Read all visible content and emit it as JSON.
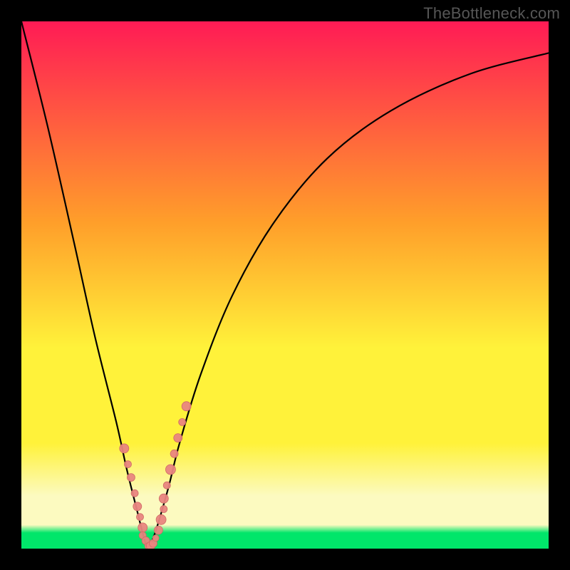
{
  "watermark": "TheBottleneck.com",
  "colors": {
    "gradient_top": "#ff1b55",
    "gradient_mid1": "#ff9e2a",
    "gradient_mid2": "#fff23a",
    "gradient_pale": "#fcfac0",
    "gradient_bottom": "#00e66a",
    "frame": "#000000",
    "curve": "#000000",
    "marker_fill": "#e9857f",
    "marker_stroke": "#cf6b65"
  },
  "chart_data": {
    "type": "line",
    "title": "",
    "xlabel": "",
    "ylabel": "",
    "xlim": [
      0,
      100
    ],
    "ylim": [
      0,
      100
    ],
    "notch_x": 24,
    "series": [
      {
        "name": "bottleneck-curve",
        "x": [
          0,
          5,
          10,
          14,
          18,
          20,
          22,
          23,
          24,
          25,
          26,
          28,
          30,
          34,
          40,
          48,
          58,
          70,
          85,
          100
        ],
        "values": [
          100,
          80,
          58,
          40,
          24,
          15,
          7,
          3,
          0,
          2,
          5,
          12,
          20,
          33,
          48,
          62,
          74,
          83,
          90,
          94
        ]
      }
    ],
    "markers": {
      "name": "sample-points",
      "x": [
        19.5,
        20.2,
        20.8,
        21.5,
        22.0,
        22.5,
        23.0,
        23.0,
        23.6,
        24.0,
        24.5,
        25.0,
        25.5,
        26.0,
        26.5,
        27.0,
        27.0,
        27.6,
        28.3,
        29.0,
        29.7,
        30.5,
        31.3
      ],
      "y": [
        19.0,
        16.0,
        13.5,
        10.5,
        8.0,
        6.0,
        4.0,
        2.5,
        1.5,
        0.5,
        0.5,
        1.0,
        2.0,
        3.5,
        5.5,
        7.5,
        9.5,
        12.0,
        15.0,
        18.0,
        21.0,
        24.0,
        27.0
      ],
      "r": [
        6.5,
        5.0,
        5.5,
        5.0,
        6.0,
        5.0,
        6.5,
        5.0,
        5.5,
        4.5,
        6.0,
        5.5,
        4.5,
        6.0,
        7.0,
        5.0,
        6.5,
        5.0,
        7.0,
        5.5,
        6.0,
        5.0,
        6.5
      ]
    }
  }
}
